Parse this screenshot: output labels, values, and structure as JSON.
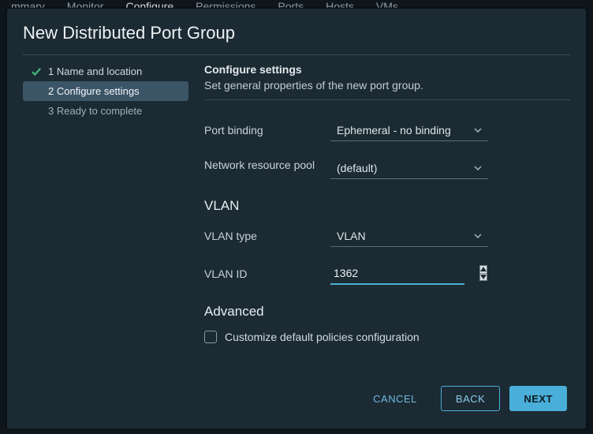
{
  "bg_tabs": {
    "t0": "mmary",
    "t1": "Monitor",
    "t2": "Configure",
    "t3": "Permissions",
    "t4": "Ports",
    "t5": "Hosts",
    "t6": "VMs"
  },
  "dialog": {
    "title": "New Distributed Port Group"
  },
  "steps": {
    "s1": "1 Name and location",
    "s2": "2 Configure settings",
    "s3": "3 Ready to complete"
  },
  "configure": {
    "heading": "Configure settings",
    "desc": "Set general properties of the new port group.",
    "port_binding_label": "Port binding",
    "port_binding_value": "Ephemeral - no binding",
    "nrp_label": "Network resource pool",
    "nrp_value": "(default)",
    "vlan_heading": "VLAN",
    "vlan_type_label": "VLAN type",
    "vlan_type_value": "VLAN",
    "vlan_id_label": "VLAN ID",
    "vlan_id_value": "1362",
    "advanced_heading": "Advanced",
    "advanced_chk_label": "Customize default policies configuration"
  },
  "buttons": {
    "cancel": "CANCEL",
    "back": "BACK",
    "next": "NEXT"
  }
}
